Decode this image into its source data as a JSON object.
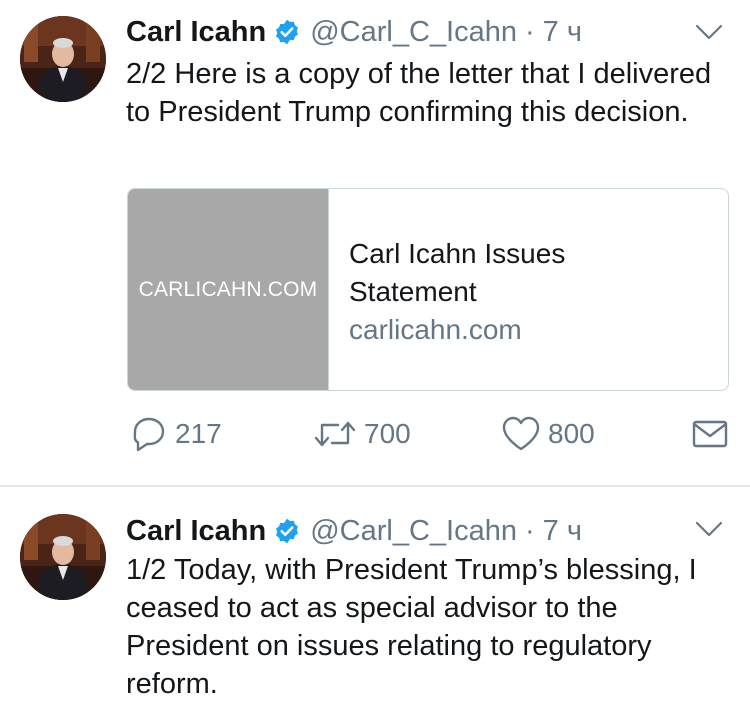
{
  "tweets": [
    {
      "author_name": "Carl Icahn",
      "handle": "@Carl_C_Icahn",
      "separator": "·",
      "time": "7 ч",
      "text": "2/2 Here is a copy of the letter that I delivered to President Trump confirming this decision.",
      "card": {
        "image_label": "CARLICAHN.COM",
        "title": "Carl Icahn Issues Statement",
        "domain": "carlicahn.com"
      },
      "actions": {
        "replies": "217",
        "retweets": "700",
        "likes": "800"
      }
    },
    {
      "author_name": "Carl Icahn",
      "handle": "@Carl_C_Icahn",
      "separator": "·",
      "time": "7 ч",
      "text": "1/2 Today, with President Trump’s blessing, I ceased to act as special advisor to the President on issues relating to regulatory reform."
    }
  ],
  "icons": {
    "verified": "verified-badge-icon",
    "caret": "chevron-down-icon",
    "reply": "reply-icon",
    "retweet": "retweet-icon",
    "like": "heart-icon",
    "dm": "envelope-icon"
  },
  "colors": {
    "text_primary": "#14171a",
    "text_secondary": "#657786",
    "verified_blue": "#1da1f2",
    "divider": "#e1e8ed",
    "card_border": "#ccd6dd",
    "card_image_bg": "#a8a8a8"
  }
}
